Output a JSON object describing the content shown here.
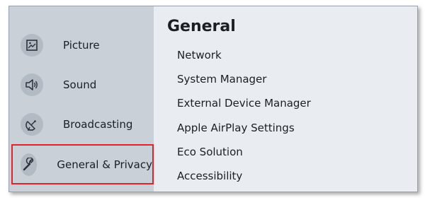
{
  "sidebar": {
    "items": [
      {
        "label": "Picture",
        "icon": "picture-icon"
      },
      {
        "label": "Sound",
        "icon": "sound-icon"
      },
      {
        "label": "Broadcasting",
        "icon": "broadcasting-icon"
      },
      {
        "label": "General & Privacy",
        "icon": "wrench-icon",
        "selected": true
      }
    ]
  },
  "main": {
    "title": "General",
    "items": [
      {
        "label": "Network"
      },
      {
        "label": "System Manager"
      },
      {
        "label": "External Device Manager"
      },
      {
        "label": "Apple AirPlay Settings"
      },
      {
        "label": "Eco Solution"
      },
      {
        "label": "Accessibility"
      }
    ]
  },
  "colors": {
    "sidebar_bg": "#c9d0d8",
    "main_bg": "#e9edf1",
    "selection_border": "#e0242c"
  }
}
